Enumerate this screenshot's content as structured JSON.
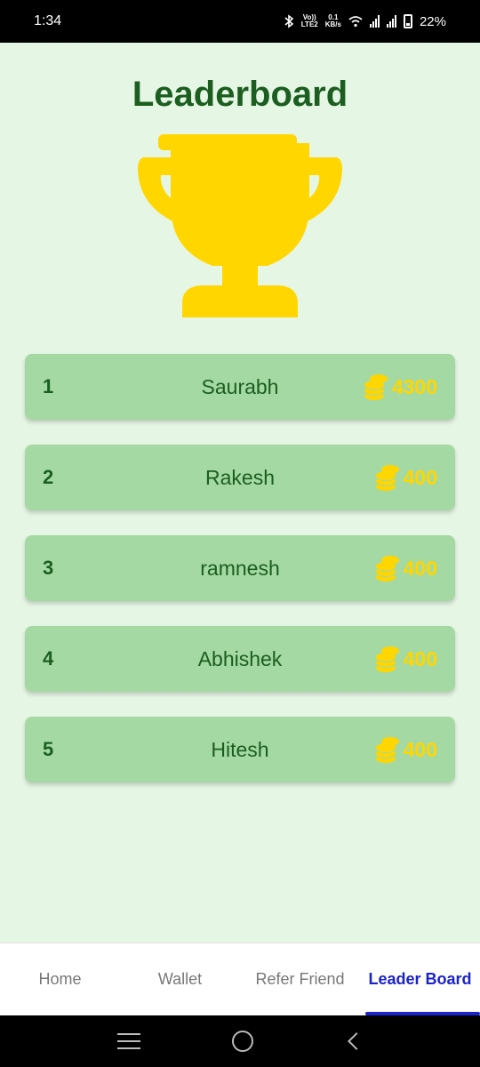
{
  "status_bar": {
    "time": "1:34",
    "network_top": "Vo))",
    "network_bottom": "LTE2",
    "speed_top": "0.1",
    "speed_bottom": "KB/s",
    "battery": "22%"
  },
  "page": {
    "title": "Leaderboard",
    "trophy_icon": "trophy-icon",
    "trophy_color": "#FFD600"
  },
  "leaderboard": [
    {
      "rank": "1",
      "name": "Saurabh",
      "score": "4300"
    },
    {
      "rank": "2",
      "name": "Rakesh",
      "score": "400"
    },
    {
      "rank": "3",
      "name": "ramnesh",
      "score": "400"
    },
    {
      "rank": "4",
      "name": "Abhishek",
      "score": "400"
    },
    {
      "rank": "5",
      "name": "Hitesh",
      "score": "400"
    }
  ],
  "bottom_nav": {
    "items": [
      {
        "label": "Home"
      },
      {
        "label": "Wallet"
      },
      {
        "label": "Refer Friend"
      },
      {
        "label": "Leader Board"
      }
    ],
    "active_index": 3,
    "active_color": "#1A22C9"
  },
  "colors": {
    "background": "#E6F6E5",
    "row_background": "#A5D9A3",
    "text_green": "#1B5E20",
    "coin_yellow": "#FFD600"
  }
}
